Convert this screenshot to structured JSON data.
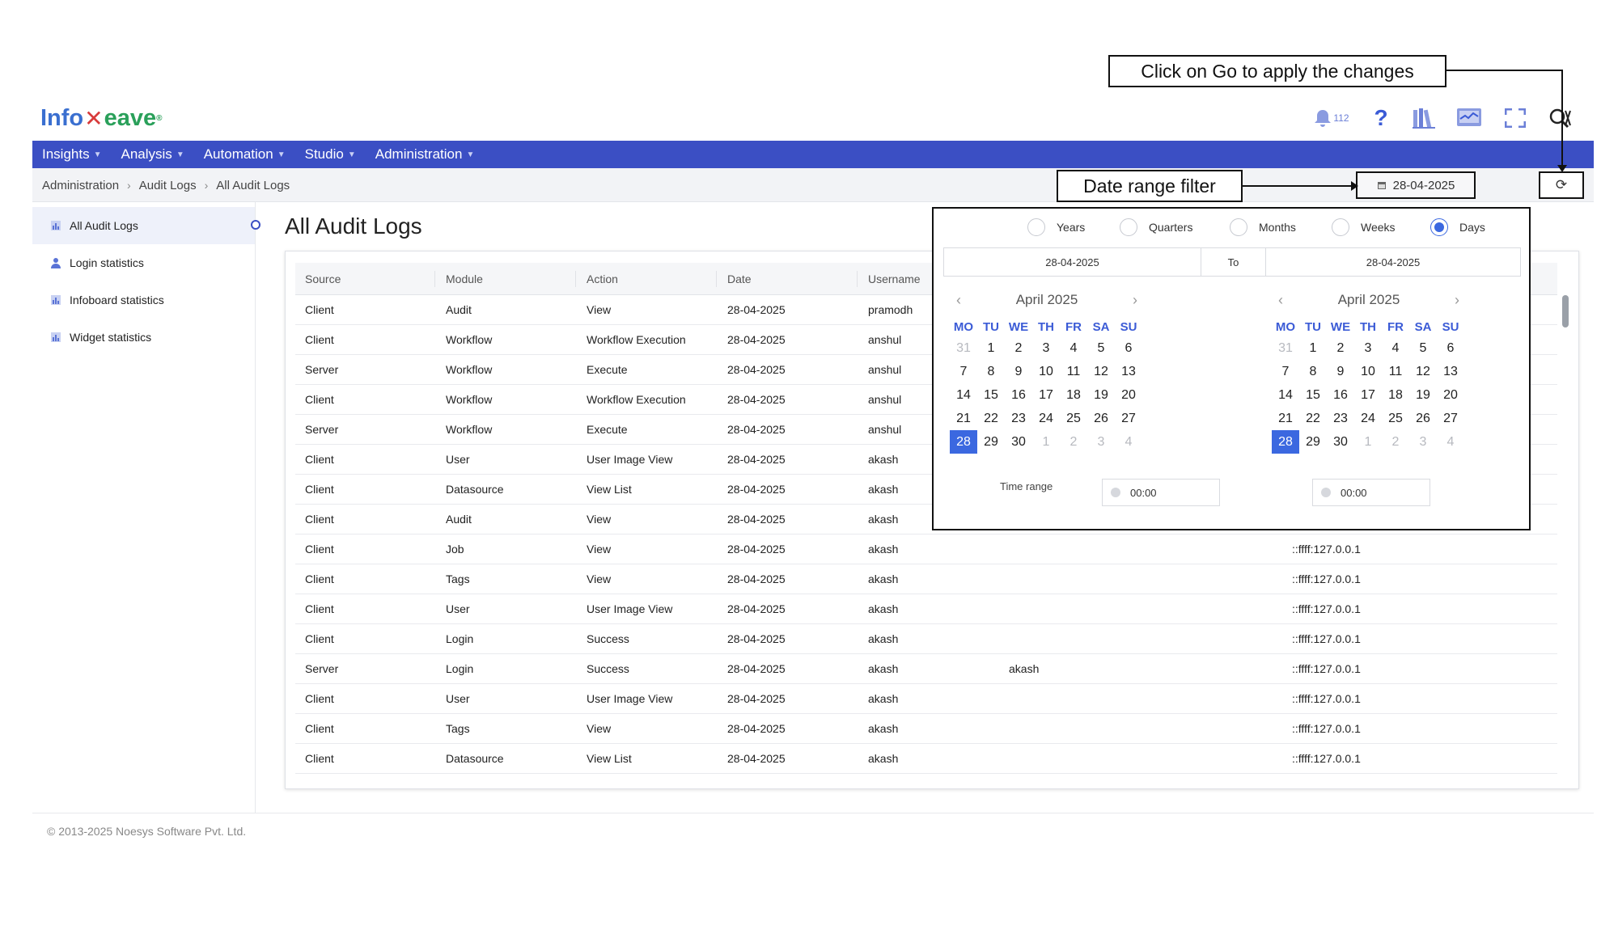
{
  "brand": {
    "part1": "Info",
    "part2": "eave",
    "trademark": "®"
  },
  "header": {
    "notification_count": "112",
    "help_glyph": "?"
  },
  "nav": [
    "Insights",
    "Analysis",
    "Automation",
    "Studio",
    "Administration"
  ],
  "breadcrumb": [
    "Administration",
    "Audit Logs",
    "All Audit Logs"
  ],
  "date_filter": {
    "value": "28-04-2025"
  },
  "annotations": {
    "go": "Click on Go to apply the changes",
    "date_range": "Date range filter"
  },
  "sidebar": {
    "items": [
      {
        "label": "All Audit Logs",
        "icon": "chart-icon",
        "active": true
      },
      {
        "label": "Login statistics",
        "icon": "user-icon",
        "active": false
      },
      {
        "label": "Infoboard statistics",
        "icon": "chart-icon",
        "active": false
      },
      {
        "label": "Widget statistics",
        "icon": "chart-icon",
        "active": false
      }
    ]
  },
  "page_title": "All Audit Logs",
  "table": {
    "columns": [
      "Source",
      "Module",
      "Action",
      "Date",
      "Username"
    ],
    "rows": [
      {
        "source": "Client",
        "module": "Audit",
        "action": "View",
        "date": "28-04-2025",
        "username": "pramodh",
        "extra": "",
        "ip": ""
      },
      {
        "source": "Client",
        "module": "Workflow",
        "action": "Workflow Execution",
        "date": "28-04-2025",
        "username": "anshul",
        "extra": "",
        "ip": ""
      },
      {
        "source": "Server",
        "module": "Workflow",
        "action": "Execute",
        "date": "28-04-2025",
        "username": "anshul",
        "extra": "",
        "ip": ""
      },
      {
        "source": "Client",
        "module": "Workflow",
        "action": "Workflow Execution",
        "date": "28-04-2025",
        "username": "anshul",
        "extra": "",
        "ip": ""
      },
      {
        "source": "Server",
        "module": "Workflow",
        "action": "Execute",
        "date": "28-04-2025",
        "username": "anshul",
        "extra": "",
        "ip": ""
      },
      {
        "source": "Client",
        "module": "User",
        "action": "User Image View",
        "date": "28-04-2025",
        "username": "akash",
        "extra": "",
        "ip": ""
      },
      {
        "source": "Client",
        "module": "Datasource",
        "action": "View List",
        "date": "28-04-2025",
        "username": "akash",
        "extra": "",
        "ip": ""
      },
      {
        "source": "Client",
        "module": "Audit",
        "action": "View",
        "date": "28-04-2025",
        "username": "akash",
        "extra": "",
        "ip": ""
      },
      {
        "source": "Client",
        "module": "Job",
        "action": "View",
        "date": "28-04-2025",
        "username": "akash",
        "extra": "",
        "ip": "::ffff:127.0.0.1"
      },
      {
        "source": "Client",
        "module": "Tags",
        "action": "View",
        "date": "28-04-2025",
        "username": "akash",
        "extra": "",
        "ip": "::ffff:127.0.0.1"
      },
      {
        "source": "Client",
        "module": "User",
        "action": "User Image View",
        "date": "28-04-2025",
        "username": "akash",
        "extra": "",
        "ip": "::ffff:127.0.0.1"
      },
      {
        "source": "Client",
        "module": "Login",
        "action": "Success",
        "date": "28-04-2025",
        "username": "akash",
        "extra": "",
        "ip": "::ffff:127.0.0.1"
      },
      {
        "source": "Server",
        "module": "Login",
        "action": "Success",
        "date": "28-04-2025",
        "username": "akash",
        "extra": "akash",
        "ip": "::ffff:127.0.0.1"
      },
      {
        "source": "Client",
        "module": "User",
        "action": "User Image View",
        "date": "28-04-2025",
        "username": "akash",
        "extra": "",
        "ip": "::ffff:127.0.0.1"
      },
      {
        "source": "Client",
        "module": "Tags",
        "action": "View",
        "date": "28-04-2025",
        "username": "akash",
        "extra": "",
        "ip": "::ffff:127.0.0.1"
      },
      {
        "source": "Client",
        "module": "Datasource",
        "action": "View List",
        "date": "28-04-2025",
        "username": "akash",
        "extra": "",
        "ip": "::ffff:127.0.0.1"
      }
    ]
  },
  "picker": {
    "granularity": [
      "Years",
      "Quarters",
      "Months",
      "Weeks",
      "Days"
    ],
    "selected_granularity": "Days",
    "from": "28-04-2025",
    "to_label": "To",
    "to": "28-04-2025",
    "time_range_label": "Time range",
    "start_time": "00:00",
    "end_time": "00:00",
    "calendars": [
      {
        "month": "April 2025"
      },
      {
        "month": "April 2025"
      }
    ],
    "weekdays": [
      "MO",
      "TU",
      "WE",
      "TH",
      "FR",
      "SA",
      "SU"
    ],
    "days": [
      "31",
      "1",
      "2",
      "3",
      "4",
      "5",
      "6",
      "7",
      "8",
      "9",
      "10",
      "11",
      "12",
      "13",
      "14",
      "15",
      "16",
      "17",
      "18",
      "19",
      "20",
      "21",
      "22",
      "23",
      "24",
      "25",
      "26",
      "27",
      "28",
      "29",
      "30",
      "1",
      "2",
      "3",
      "4"
    ],
    "muted_indices": [
      0,
      31,
      32,
      33,
      34
    ],
    "selected_index": 28,
    "prev_glyph": "‹",
    "next_glyph": "›"
  },
  "footer": "© 2013-2025 Noesys Software Pvt. Ltd.",
  "colors": {
    "navbar": "#3b4fc4",
    "accent": "#3b68e0",
    "brand_blue": "#3a6fd0",
    "brand_green": "#2aa05a"
  }
}
